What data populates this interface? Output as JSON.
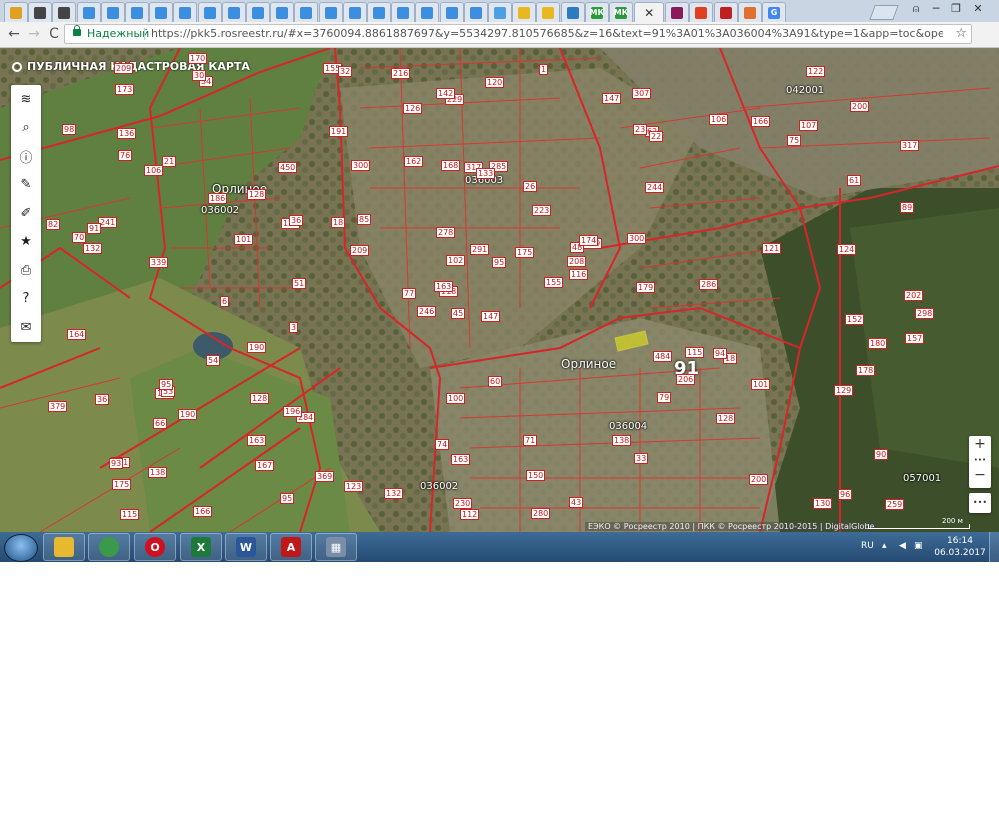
{
  "browser": {
    "tabs": [
      {
        "icon": "mail-icon",
        "color": "#e0a020"
      },
      {
        "icon": "r-icon",
        "color": "#444444"
      },
      {
        "icon": "r-icon",
        "color": "#444444"
      },
      {
        "icon": "paw-icon",
        "color": "#3b8ee0"
      },
      {
        "icon": "paw-icon",
        "color": "#3b8ee0"
      },
      {
        "icon": "paw-icon",
        "color": "#3b8ee0"
      },
      {
        "icon": "paw-icon",
        "color": "#3b8ee0"
      },
      {
        "icon": "paw-icon",
        "color": "#3b8ee0"
      },
      {
        "icon": "paw-icon",
        "color": "#3b8ee0"
      },
      {
        "icon": "paw-icon",
        "color": "#3b8ee0"
      },
      {
        "icon": "paw-icon",
        "color": "#3b8ee0"
      },
      {
        "icon": "paw-icon",
        "color": "#3b8ee0"
      },
      {
        "icon": "paw-icon",
        "color": "#3b8ee0"
      },
      {
        "icon": "paw-icon",
        "color": "#3b8ee0"
      },
      {
        "icon": "paw-icon",
        "color": "#3b8ee0"
      },
      {
        "icon": "paw-icon",
        "color": "#3b8ee0"
      },
      {
        "icon": "paw-icon",
        "color": "#3b8ee0"
      },
      {
        "icon": "paw-icon",
        "color": "#3b8ee0"
      },
      {
        "icon": "paw-icon",
        "color": "#3b8ee0"
      },
      {
        "icon": "paw-icon",
        "color": "#3b8ee0"
      },
      {
        "icon": "pin-icon",
        "color": "#4aa0e0"
      },
      {
        "icon": "hand-icon",
        "color": "#e8b820"
      },
      {
        "icon": "hand-icon",
        "color": "#e8b820"
      },
      {
        "icon": "camera-icon",
        "color": "#2b7bc0"
      },
      {
        "icon": "mk-icon",
        "color": "#2a9a3a",
        "text": "МК"
      },
      {
        "icon": "mk-icon",
        "color": "#2a9a3a",
        "text": "МК"
      }
    ],
    "active_tab_close": "✕",
    "trailing_tabs": [
      {
        "icon": "spb-icon",
        "color": "#8a1a5a"
      },
      {
        "icon": "wiki-icon",
        "color": "#e04020"
      },
      {
        "icon": "pc-icon",
        "color": "#c02020"
      },
      {
        "icon": "orange-icon",
        "color": "#e07030"
      },
      {
        "icon": "google-icon",
        "color": "#4285f4",
        "text": "G"
      }
    ],
    "window_controls": {
      "profile": "⍝",
      "minimize": "─",
      "restore": "❐",
      "close": "✕"
    },
    "nav": {
      "back": "←",
      "forward": "→",
      "reload": "C"
    },
    "omnibox": {
      "secure_label": "Надежный",
      "url": "https://pkk5.rosreestr.ru/#x=3760094.8861887697&y=5534297.810576685&z=16&text=91%3A01%3A036004%3A91&type=1&app=toc&opened=0",
      "star": "☆"
    },
    "menu": "⋮"
  },
  "map": {
    "title": "ПУБЛИЧНАЯ КАДАСТРОВАЯ КАРТА",
    "sidebar": [
      {
        "name": "layers-icon",
        "glyph": "≋"
      },
      {
        "name": "search-icon",
        "glyph": "⌕"
      },
      {
        "name": "info-icon",
        "glyph": "ⓘ"
      },
      {
        "name": "pencil-icon",
        "glyph": "✎"
      },
      {
        "name": "measure-icon",
        "glyph": "✐"
      },
      {
        "name": "star-icon",
        "glyph": "★"
      },
      {
        "name": "print-icon",
        "glyph": "⎙"
      },
      {
        "name": "help-icon",
        "glyph": "?"
      },
      {
        "name": "mail-icon",
        "glyph": "✉"
      }
    ],
    "zoom_in": "+",
    "zoom_more": "•••",
    "zoom_out": "−",
    "more": "•••",
    "place_labels": [
      "Орлиное",
      "Орлиное"
    ],
    "quarter_labels": [
      "036002",
      "036003",
      "036004",
      "036002",
      "042001",
      "057001"
    ],
    "selected_parcel": "91",
    "parcel_numbers": [
      "147",
      "106",
      "118",
      "131",
      "48",
      "284",
      "307",
      "285",
      "62",
      "155",
      "34",
      "259",
      "339",
      "317",
      "246",
      "244",
      "166",
      "168",
      "223",
      "190",
      "85",
      "175",
      "167",
      "317",
      "319",
      "18",
      "21",
      "229",
      "132",
      "484",
      "89",
      "163",
      "74",
      "102",
      "450",
      "106",
      "196",
      "130",
      "90",
      "94",
      "1",
      "18",
      "101",
      "79",
      "95",
      "82",
      "208",
      "115",
      "163",
      "116",
      "66",
      "61",
      "98",
      "206",
      "33",
      "163",
      "30",
      "209",
      "71",
      "107",
      "120",
      "51",
      "241",
      "128",
      "166",
      "170",
      "147",
      "126",
      "291",
      "379",
      "100",
      "123",
      "115",
      "125",
      "93",
      "173",
      "186",
      "164",
      "278",
      "150",
      "175",
      "138",
      "179",
      "178",
      "230",
      "124",
      "60",
      "200",
      "280",
      "138",
      "142",
      "298",
      "300",
      "128",
      "95",
      "129",
      "91",
      "112",
      "23",
      "22",
      "6",
      "155",
      "202",
      "70",
      "54",
      "128",
      "369",
      "174",
      "75",
      "209",
      "152",
      "136",
      "133",
      "77",
      "32",
      "36",
      "45",
      "200",
      "162",
      "216",
      "100",
      "122",
      "26",
      "300",
      "286",
      "190",
      "96",
      "132",
      "121",
      "76",
      "53",
      "43",
      "36",
      "191",
      "180",
      "101",
      "3",
      "95",
      "157"
    ],
    "copyright": "ЕЭКО © Росреестр 2010 | ПКК © Росреестр 2010-2015 | DigitalGlobe",
    "scale": "200 м"
  },
  "taskbar": {
    "apps": [
      {
        "name": "explorer-icon",
        "color": "#e8b830",
        "text": ""
      },
      {
        "name": "chrome-icon",
        "color": "#3a9a4a",
        "text": ""
      },
      {
        "name": "opera-icon",
        "color": "#d01020",
        "text": "O"
      },
      {
        "name": "excel-icon",
        "color": "#1e7a3a",
        "text": "X"
      },
      {
        "name": "word-icon",
        "color": "#2b579a",
        "text": "W"
      },
      {
        "name": "acrobat-icon",
        "color": "#c01818",
        "text": "A"
      },
      {
        "name": "calculator-icon",
        "color": "#7a8ea8",
        "text": "▦"
      }
    ],
    "lang": "RU",
    "time": "16:14",
    "date": "06.03.2017"
  }
}
